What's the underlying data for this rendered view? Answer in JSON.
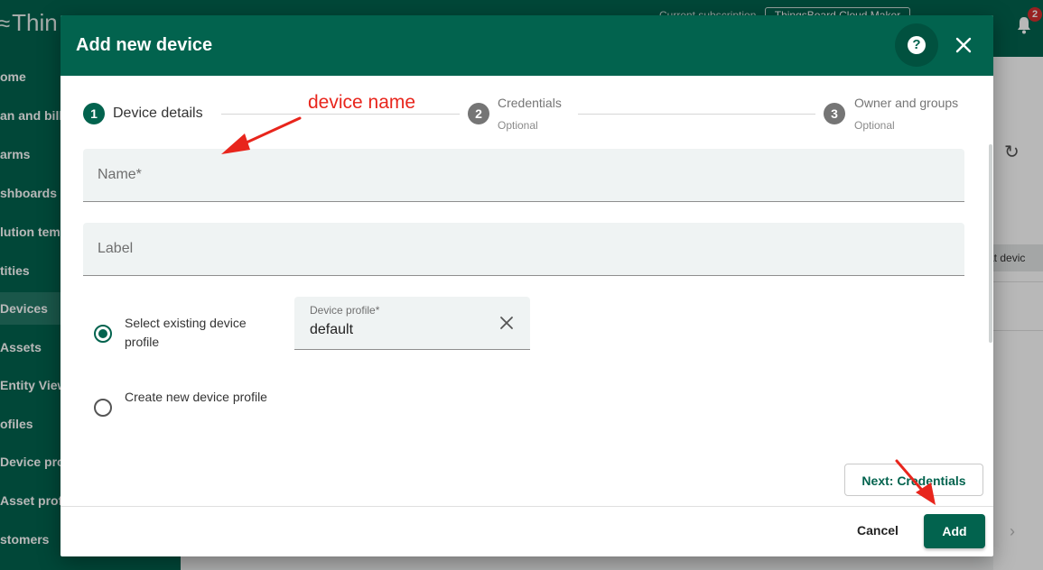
{
  "app": {
    "logo_text": "Thin",
    "subscription_label": "Current subscription",
    "subscription_plan": "ThingsBoard Cloud Maker",
    "notification_count": "2"
  },
  "sidebar": {
    "items": [
      {
        "label": "ome"
      },
      {
        "label": "an and billing"
      },
      {
        "label": "arms"
      },
      {
        "label": "shboards"
      },
      {
        "label": "lution templates"
      },
      {
        "label": "tities"
      },
      {
        "label": "Devices"
      },
      {
        "label": "Assets"
      },
      {
        "label": "Entity Views"
      },
      {
        "label": "ofiles"
      },
      {
        "label": "Device profiles"
      },
      {
        "label": "Asset profiles"
      },
      {
        "label": "stomers"
      }
    ]
  },
  "background": {
    "chip_text": "at devic"
  },
  "dialog": {
    "title": "Add new device",
    "steps": [
      {
        "number": "1",
        "label": "Device details",
        "optional": ""
      },
      {
        "number": "2",
        "label": "Credentials",
        "optional": "Optional"
      },
      {
        "number": "3",
        "label": "Owner and groups",
        "optional": "Optional"
      }
    ],
    "name_field": {
      "placeholder": "Name*",
      "value": ""
    },
    "label_field": {
      "placeholder": "Label",
      "value": ""
    },
    "profile_options": {
      "existing": "Select existing device profile",
      "create": "Create new device profile",
      "selected": "existing"
    },
    "device_profile": {
      "label": "Device profile*",
      "value": "default"
    },
    "next_button": "Next: Credentials",
    "cancel_button": "Cancel",
    "add_button": "Add"
  },
  "annotation": {
    "text": "device name",
    "color": "#e8251c"
  },
  "colors": {
    "brand": "#02634e"
  }
}
